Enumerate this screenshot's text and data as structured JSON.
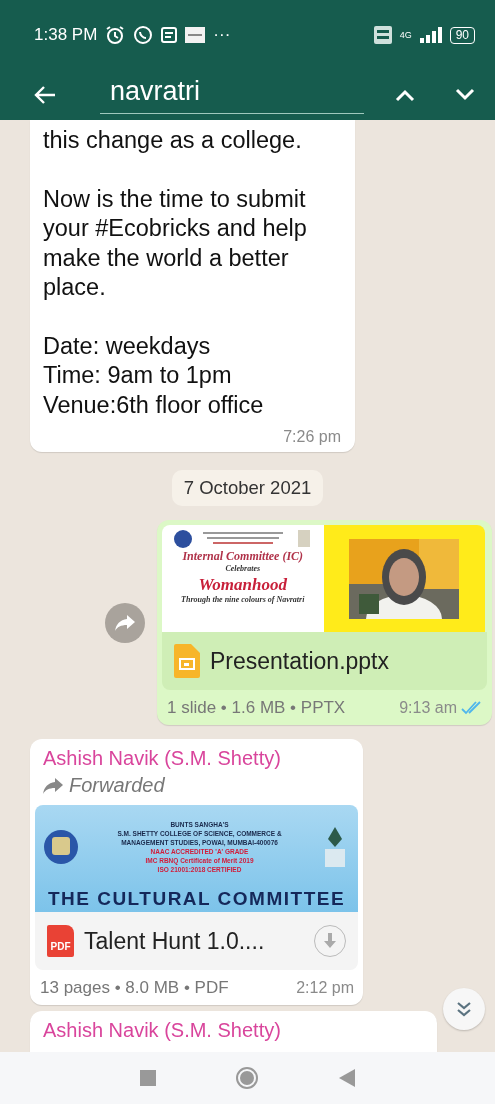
{
  "status_bar": {
    "time": "1:38 PM",
    "more": "···",
    "network": "4G",
    "battery": "90"
  },
  "search_bar": {
    "query": "navratri"
  },
  "messages": [
    {
      "kind": "text",
      "outgoing": false,
      "paragraphs": [
        "this change as a college.",
        "Now is the time to submit your #Ecobricks and help make the world a better place.",
        "Date: weekdays\nTime: 9am to 1pm\nVenue:6th floor office"
      ],
      "time": "7:26 pm"
    },
    {
      "kind": "date",
      "text": "7 October 2021"
    },
    {
      "kind": "document",
      "outgoing": true,
      "preview": {
        "kind": "slides",
        "title": "Internal Committee (IC)",
        "subtitle": "Celebrates",
        "heading": "Womanhood",
        "footer": "Through the nine colours of Navratri"
      },
      "file": {
        "kind": "slides",
        "name": "Presentation.pptx"
      },
      "meta": "1 slide • 1.6 MB • PPTX",
      "time": "9:13 am",
      "read": true,
      "forward_button": true
    },
    {
      "kind": "document",
      "outgoing": false,
      "sender": "Ashish Navik (S.M. Shetty)",
      "forwarded": "Forwarded",
      "preview": {
        "kind": "banner",
        "lines": [
          {
            "text": "BUNTS SANGHA'S",
            "emphasis": false
          },
          {
            "text": "S.M. SHETTY COLLEGE OF SCIENCE, COMMERCE &",
            "emphasis": false
          },
          {
            "text": "MANAGEMENT STUDIES, POWAI, MUMBAI-400076",
            "emphasis": false
          },
          {
            "text": "NAAC ACCREDITED 'A' GRADE",
            "emphasis": true
          },
          {
            "text": "IMC RBNQ Certificate of Merit 2019",
            "emphasis": true
          },
          {
            "text": "ISO 21001:2018 CERTIFIED",
            "emphasis": true
          }
        ],
        "title": "THE CULTURAL COMMITTEE"
      },
      "file": {
        "kind": "pdf",
        "badge": "PDF",
        "name": "Talent Hunt 1.0...."
      },
      "download": true,
      "meta": "13 pages • 8.0 MB • PDF",
      "time": "2:12 pm"
    },
    {
      "kind": "partial",
      "outgoing": false,
      "sender": "Ashish Navik (S.M. Shetty)"
    }
  ]
}
